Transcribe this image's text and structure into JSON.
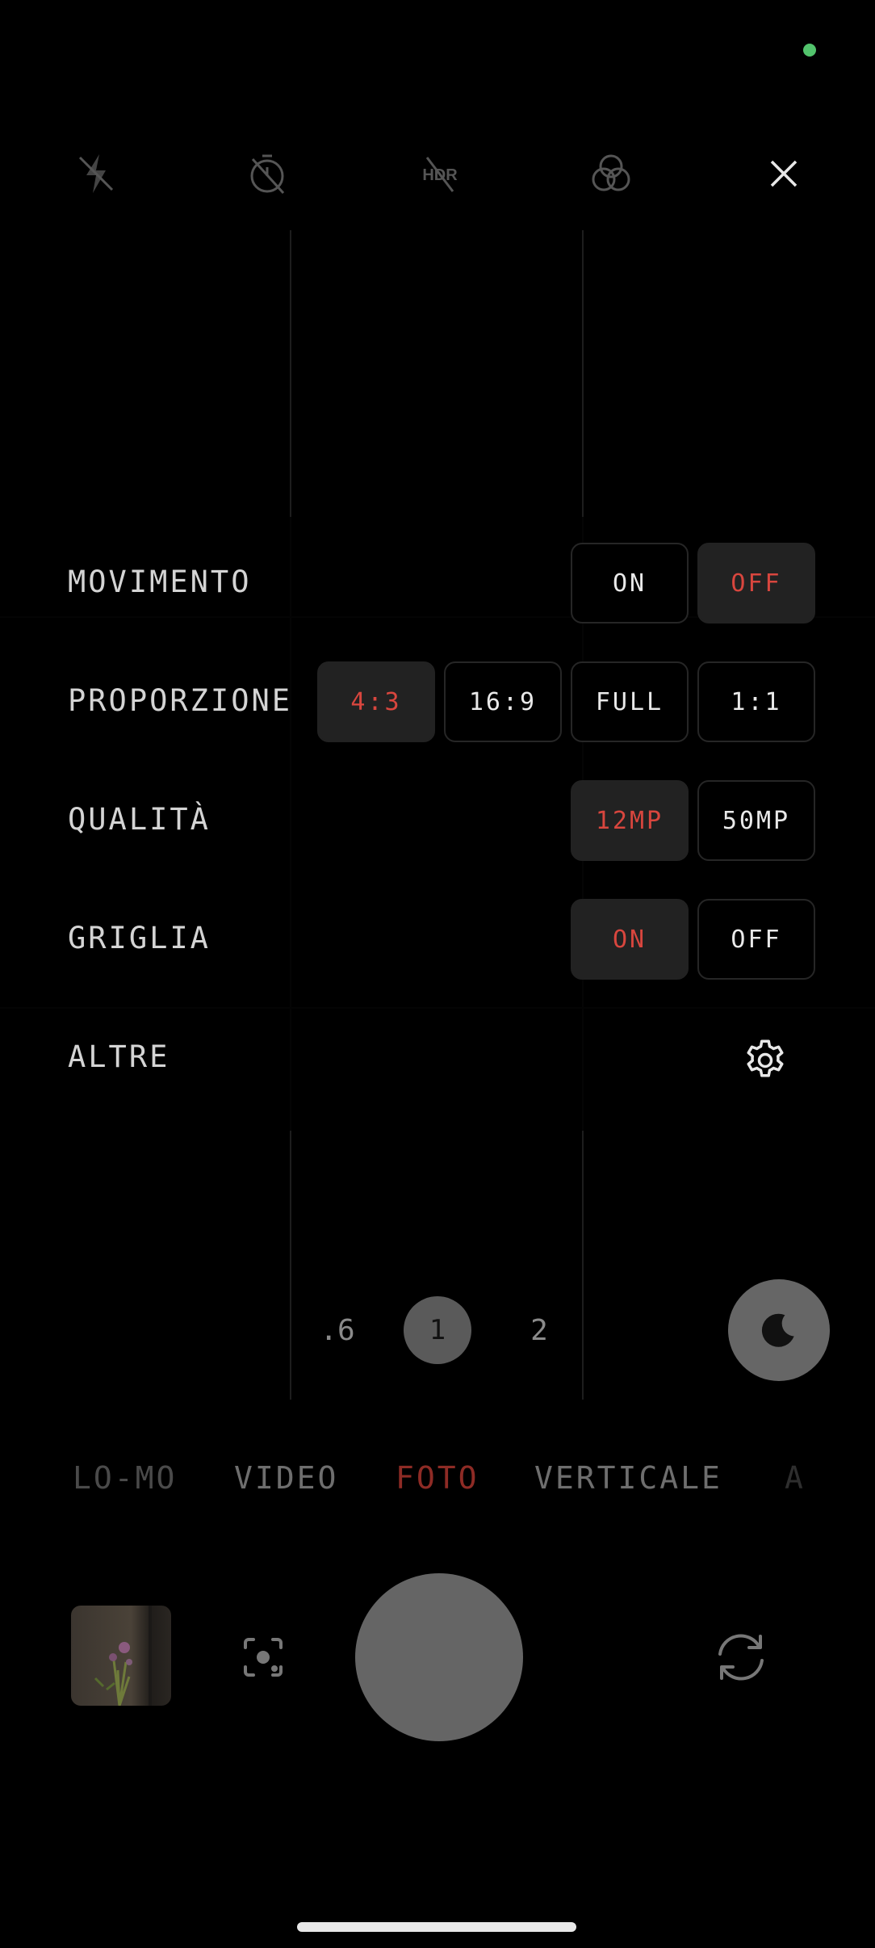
{
  "top_bar": {
    "icons": [
      "flash-off-icon",
      "timer-off-icon",
      "hdr-off-icon",
      "filters-icon",
      "close-icon"
    ]
  },
  "settings": {
    "rows": [
      {
        "label": "MOVIMENTO",
        "options": [
          "ON",
          "OFF"
        ],
        "selected": "OFF"
      },
      {
        "label": "PROPORZIONE",
        "options": [
          "4:3",
          "16:9",
          "FULL",
          "1:1"
        ],
        "selected": "4:3"
      },
      {
        "label": "QUALITÀ",
        "options": [
          "12MP",
          "50MP"
        ],
        "selected": "12MP"
      },
      {
        "label": "GRIGLIA",
        "options": [
          "ON",
          "OFF"
        ],
        "selected": "ON"
      },
      {
        "label": "ALTRE",
        "icon": "gear-icon"
      }
    ]
  },
  "zoom": {
    "options": [
      ".6",
      "1",
      "2"
    ],
    "selected": "1"
  },
  "modes": {
    "items": [
      "LO-MO",
      "VIDEO",
      "FOTO",
      "VERTICALE",
      "A"
    ],
    "selected": "FOTO"
  },
  "colors": {
    "accent": "#d8463e",
    "status": "#52c36c",
    "background": "#000000"
  }
}
